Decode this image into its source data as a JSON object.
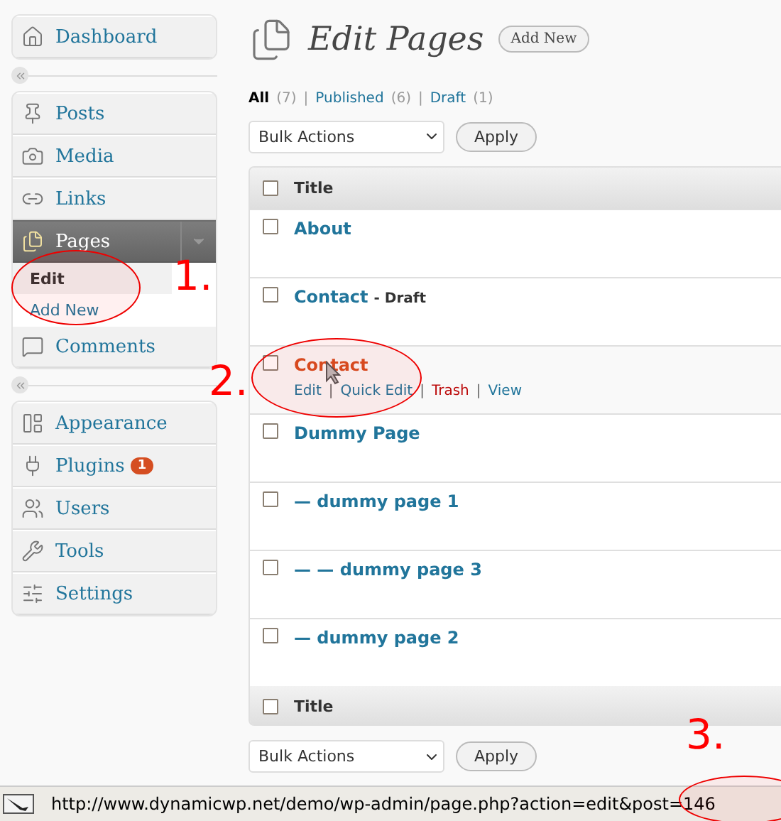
{
  "sidebar": {
    "groups": [
      {
        "items": [
          {
            "label": "Dashboard",
            "selected": false
          }
        ]
      },
      {
        "items": [
          {
            "label": "Posts",
            "selected": false
          },
          {
            "label": "Media",
            "selected": false
          },
          {
            "label": "Links",
            "selected": false
          },
          {
            "label": "Pages",
            "selected": true,
            "children": [
              {
                "label": "Edit",
                "selected": true
              },
              {
                "label": "Add New",
                "selected": false
              }
            ]
          },
          {
            "label": "Comments",
            "selected": false
          }
        ]
      },
      {
        "items": [
          {
            "label": "Appearance",
            "selected": false
          },
          {
            "label": "Plugins",
            "selected": false,
            "badge": "1"
          },
          {
            "label": "Users",
            "selected": false
          },
          {
            "label": "Tools",
            "selected": false
          },
          {
            "label": "Settings",
            "selected": false
          }
        ]
      }
    ]
  },
  "header": {
    "title": "Edit Pages",
    "add_new": "Add New"
  },
  "filters": {
    "separator": "|",
    "items": [
      {
        "label": "All",
        "count": "(7)",
        "selected": true
      },
      {
        "label": "Published",
        "count": "(6)",
        "selected": false
      },
      {
        "label": "Draft",
        "count": "(1)",
        "selected": false
      }
    ]
  },
  "bulk_top": {
    "select": "Bulk Actions",
    "apply": "Apply"
  },
  "table": {
    "column": {
      "label": "Title",
      "checked": false
    },
    "footer": {
      "label": "Title",
      "checked": false
    },
    "action_separator": "|",
    "rows": [
      {
        "title": "About",
        "checked": false,
        "hovered": false
      },
      {
        "title": "Contact",
        "state": "- Draft",
        "checked": false,
        "hovered": false
      },
      {
        "title": "Contact",
        "checked": false,
        "hovered": true,
        "actions": [
          {
            "label": "Edit",
            "kind": "link"
          },
          {
            "label": "Quick Edit",
            "kind": "link"
          },
          {
            "label": "Trash",
            "kind": "danger"
          },
          {
            "label": "View",
            "kind": "link"
          }
        ]
      },
      {
        "title": "Dummy Page",
        "checked": false,
        "hovered": false
      },
      {
        "title": "— dummy page 1",
        "checked": false,
        "hovered": false
      },
      {
        "title": "— — dummy page 3",
        "checked": false,
        "hovered": false
      },
      {
        "title": "— dummy page 2",
        "checked": false,
        "hovered": false
      }
    ]
  },
  "bulk_bottom": {
    "select": "Bulk Actions",
    "apply": "Apply"
  },
  "status_bar": {
    "url": "http://www.dynamicwp.net/demo/wp-admin/page.php?action=edit&post=146"
  },
  "annotations": [
    "1.",
    "2.",
    "3."
  ]
}
